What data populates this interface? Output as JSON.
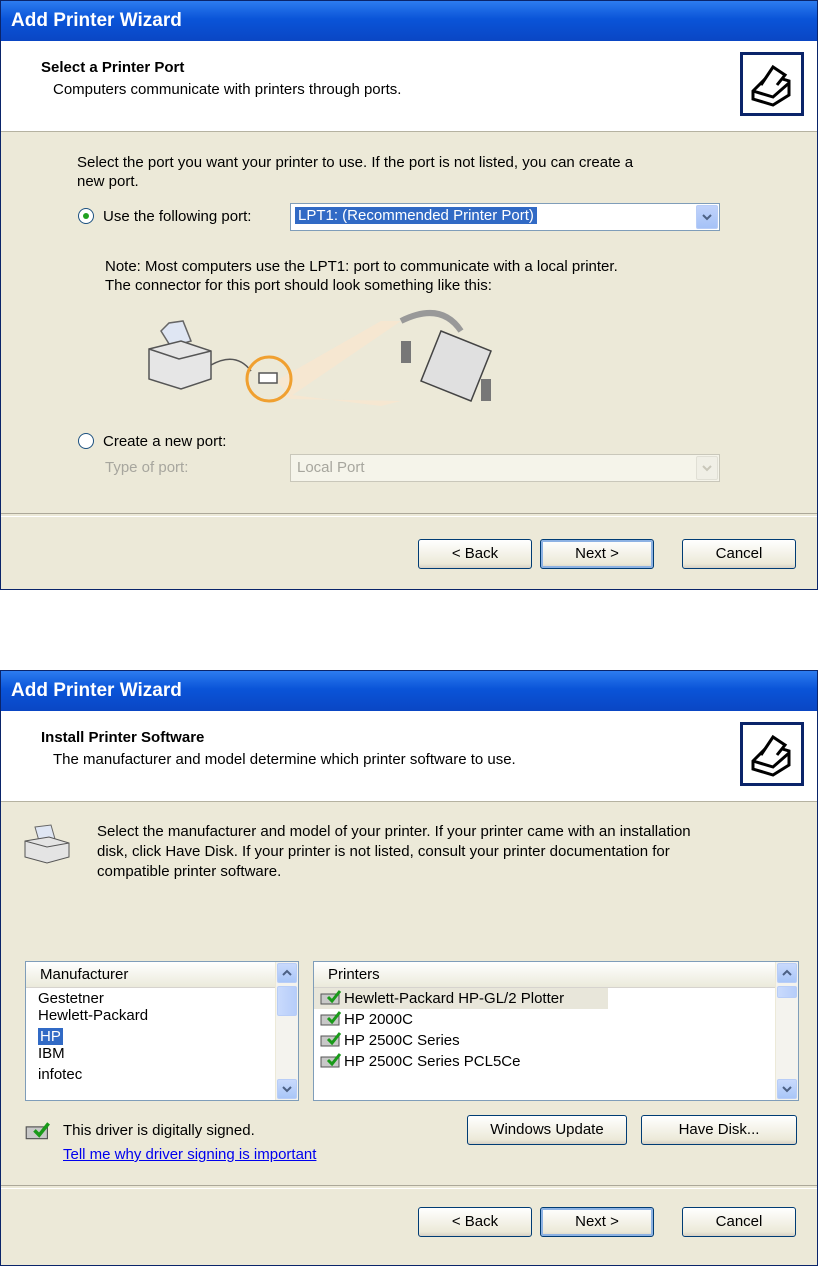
{
  "window1": {
    "title": "Add Printer Wizard",
    "header_title": "Select a Printer Port",
    "header_subtitle": "Computers communicate with printers through ports.",
    "intro_line1": "Select the port you want your printer to use.  If the port is not listed, you can create a",
    "intro_line2": "new port.",
    "use_port_label": "Use the following port:",
    "port_value": "LPT1: (Recommended Printer Port)",
    "note_line1": "Note: Most computers use the LPT1: port to communicate with a local printer.",
    "note_line2": "The connector for this port should look something like this:",
    "create_port_label": "Create a new port:",
    "type_of_port_label": "Type of port:",
    "type_of_port_value": "Local Port",
    "back_label": "< Back",
    "next_label": "Next >",
    "cancel_label": "Cancel"
  },
  "window2": {
    "title": "Add Printer Wizard",
    "header_title": "Install Printer Software",
    "header_subtitle": "The manufacturer and model determine which printer software to use.",
    "intro_line1": "Select the manufacturer and model of your printer. If your printer came with an installation",
    "intro_line2": "disk, click Have Disk. If your printer is not listed, consult your printer documentation for",
    "intro_line3": "compatible printer software.",
    "manufacturer_header": "Manufacturer",
    "manufacturers": [
      "Gestetner",
      "Hewlett-Packard",
      "HP",
      "IBM",
      "infotec"
    ],
    "printers_header": "Printers",
    "printers": [
      "Hewlett-Packard HP-GL/2 Plotter",
      "HP 2000C",
      "HP 2500C Series",
      "HP 2500C Series PCL5Ce"
    ],
    "signed_text": "This driver is digitally signed.",
    "signing_link": "Tell me why driver signing is important",
    "windows_update_label": "Windows Update",
    "have_disk_label": "Have Disk...",
    "back_label": "< Back",
    "next_label": "Next >",
    "cancel_label": "Cancel"
  },
  "colors": {
    "titlebar": "#0a54d8",
    "face": "#ece9d8",
    "selection": "#316ac5"
  }
}
